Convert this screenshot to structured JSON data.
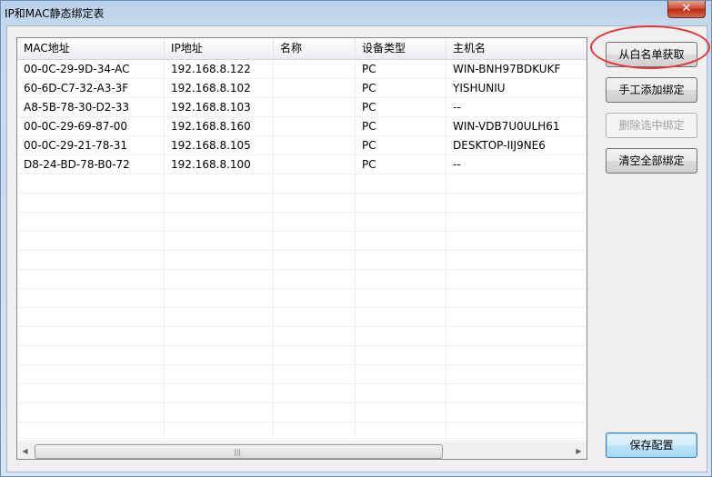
{
  "window": {
    "title": "IP和MAC静态绑定表",
    "close_glyph": "✕"
  },
  "columns": [
    {
      "label": "MAC地址"
    },
    {
      "label": "IP地址"
    },
    {
      "label": "名称"
    },
    {
      "label": "设备类型"
    },
    {
      "label": "主机名"
    }
  ],
  "rows": [
    {
      "mac": "00-0C-29-9D-34-AC",
      "ip": "192.168.8.122",
      "name": "",
      "type": "PC",
      "host": "WIN-BNH97BDKUKF"
    },
    {
      "mac": "60-6D-C7-32-A3-3F",
      "ip": "192.168.8.102",
      "name": "",
      "type": "PC",
      "host": "YISHUNIU"
    },
    {
      "mac": "A8-5B-78-30-D2-33",
      "ip": "192.168.8.103",
      "name": "",
      "type": "PC",
      "host": "--"
    },
    {
      "mac": "00-0C-29-69-87-00",
      "ip": "192.168.8.160",
      "name": "",
      "type": "PC",
      "host": "WIN-VDB7U0ULH61"
    },
    {
      "mac": "00-0C-29-21-78-31",
      "ip": "192.168.8.105",
      "name": "",
      "type": "PC",
      "host": "DESKTOP-IIJ9NE6"
    },
    {
      "mac": "D8-24-BD-78-B0-72",
      "ip": "192.168.8.100",
      "name": "",
      "type": "PC",
      "host": "--"
    }
  ],
  "buttons": {
    "from_whitelist": "从白名单获取",
    "manual_add": "手工添加绑定",
    "delete_selected": "删除选中绑定",
    "clear_all": "清空全部绑定",
    "save_config": "保存配置"
  },
  "scrollbar": {
    "left_arrow": "◀",
    "right_arrow": "▶",
    "grip": "|||"
  },
  "colors": {
    "highlight": "#e23434",
    "default_button": "#3c7fb1"
  }
}
